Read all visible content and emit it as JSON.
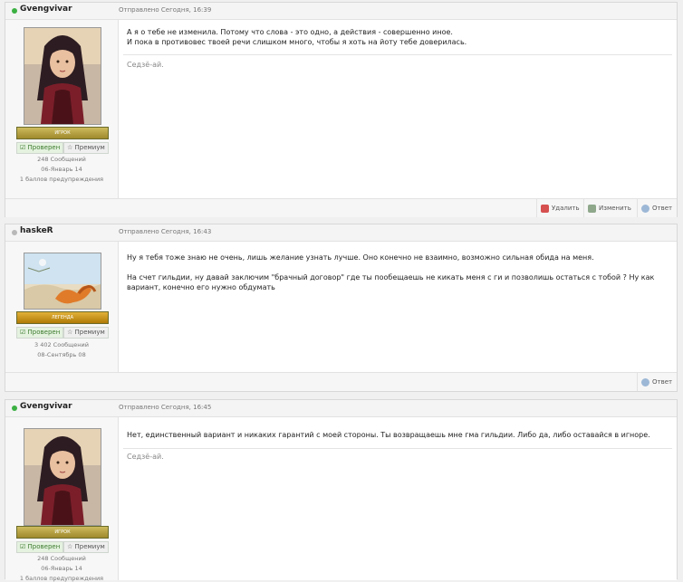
{
  "posts": [
    {
      "author": "Gvengvivar",
      "online": true,
      "date": "Отправлено Сегодня, 16:39",
      "rank": "ИГРОК",
      "verified": "Проверен",
      "premium": "Премиум",
      "meta": [
        "248 Сообщений",
        "06-Январь 14",
        "1 баллов предупреждения"
      ],
      "message": [
        "А я о тебе не изменила. Потому что слова - это одно, а действия - совершенно иное.",
        "И пока в противовес твоей речи слишком много, чтобы я хоть на йоту тебе доверилась."
      ],
      "signature": "Седзё-ай.",
      "buttons": [
        "Удалить",
        "Изменить",
        "Ответ"
      ]
    },
    {
      "author": "haskeR",
      "online": false,
      "date": "Отправлено Сегодня, 16:43",
      "rank": "ЛЕГЕНДА",
      "verified": "Проверен",
      "premium": "Премиум",
      "meta": [
        "3 402 Сообщений",
        "08-Сентябрь 08"
      ],
      "message": [
        "Ну я тебя тоже  знаю не очень, лишь желание узнать лучше. Оно конечно не взаимно, возможно сильная обида на меня.",
        "",
        "На счет гильдии, ну давай заключим \"брачный договор\" где ты пообещаешь не кикать меня с ги и позволишь остаться с тобой ? Ну как",
        "вариант, конечно его нужно обдумать"
      ],
      "buttons": [
        "Ответ"
      ]
    },
    {
      "author": "Gvengvivar",
      "online": true,
      "date": "Отправлено Сегодня, 16:45",
      "rank": "ИГРОК",
      "verified": "Проверен",
      "premium": "Премиум",
      "meta": [
        "248 Сообщений",
        "06-Январь 14",
        "1 баллов предупреждения"
      ],
      "message": [
        "Нет, единственный вариант и никаких гарантий с моей стороны. Ты возвращаешь мне гма гильдии. Либо да, либо оставайся в игноре."
      ],
      "signature": "Седзё-ай."
    }
  ],
  "colors": {
    "online": "#3cb043",
    "offline": "#b8b8b8",
    "rank_player": "#b6a23e",
    "rank_legend": "#c7940f"
  }
}
